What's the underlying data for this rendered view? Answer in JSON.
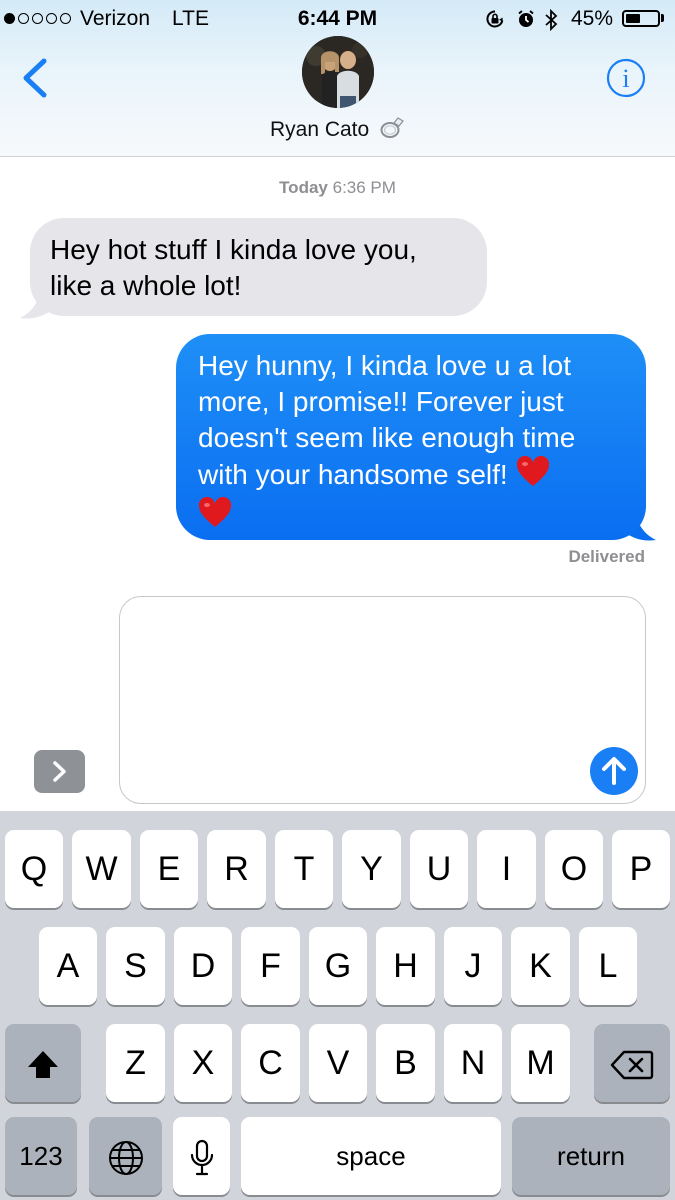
{
  "status_bar": {
    "carrier": "Verizon",
    "network": "LTE",
    "time": "6:44 PM",
    "battery_percent": "45%",
    "battery_level": 0.45,
    "signal_bars_filled": 1,
    "signal_bars_total": 5,
    "icons": [
      "orientation-lock-icon",
      "alarm-icon",
      "bluetooth-icon",
      "battery-icon"
    ]
  },
  "nav": {
    "contact_name": "Ryan Cato",
    "name_icon": "ring-icon",
    "back_icon": "chevron-left-icon",
    "info_icon": "info-icon"
  },
  "conversation": {
    "timestamp_day": "Today",
    "timestamp_time": "6:36 PM",
    "messages": [
      {
        "direction": "incoming",
        "lines": [
          "Hey hot stuff I kinda love you,",
          "like a whole lot!"
        ]
      },
      {
        "direction": "outgoing",
        "lines": [
          "Hey hunny, I kinda love u a lot",
          "more, I promise!! Forever just",
          "doesn't seem like enough time",
          "with your handsome self!"
        ],
        "emoji": [
          "red-heart",
          "red-heart"
        ],
        "status": "Delivered"
      }
    ]
  },
  "compose": {
    "expand_icon": "chevron-right-icon",
    "send_icon": "arrow-up-icon"
  },
  "keyboard": {
    "row1": [
      "Q",
      "W",
      "E",
      "R",
      "T",
      "Y",
      "U",
      "I",
      "O",
      "P"
    ],
    "row2": [
      "A",
      "S",
      "D",
      "F",
      "G",
      "H",
      "J",
      "K",
      "L"
    ],
    "row3": [
      "Z",
      "X",
      "C",
      "V",
      "B",
      "N",
      "M"
    ],
    "numbers_label": "123",
    "space_label": "space",
    "return_label": "return",
    "shift_icon": "shift-icon",
    "delete_icon": "delete-icon",
    "globe_icon": "globe-icon",
    "mic_icon": "microphone-icon"
  },
  "colors": {
    "accent": "#1a7ef5",
    "outgoing_bubble": "#0a6ef1",
    "incoming_bubble": "#e5e5ea",
    "secondary_text": "#8e8e93",
    "keyboard_bg": "#d1d4da"
  }
}
